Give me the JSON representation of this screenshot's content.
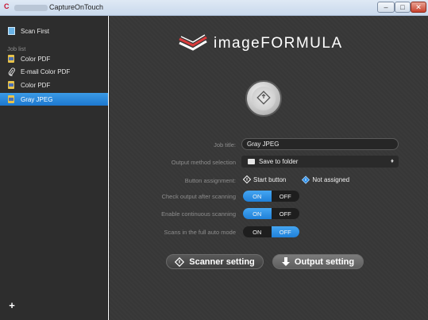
{
  "window": {
    "app_title": "CaptureOnTouch",
    "logo_text": "C",
    "controls": {
      "minimize": "–",
      "maximize": "□",
      "close": "✕"
    }
  },
  "sidebar": {
    "scan_first_label": "Scan First",
    "job_list_label": "Job list",
    "jobs": [
      {
        "label": "Color PDF",
        "icon": "pdf-icon"
      },
      {
        "label": "E-mail Color PDF",
        "icon": "paperclip-icon"
      },
      {
        "label": "Color PDF",
        "icon": "pdf-icon"
      },
      {
        "label": "Gray JPEG",
        "icon": "jpeg-icon",
        "selected": true
      }
    ],
    "add_label": "+"
  },
  "main": {
    "brand": "imageFORMULA",
    "job_title_label": "Job title:",
    "job_title_value": "Gray JPEG",
    "output_method_label": "Output method selection",
    "output_method_value": "Save to folder",
    "output_method_arrow": "♦",
    "button_assignment_label": "Button assignment:",
    "start_button_label": "Start button",
    "not_assigned_label": "Not assigned",
    "check_output_label": "Check output after scanning",
    "continuous_label": "Enable continuous scanning",
    "full_auto_label": "Scans in the full auto mode",
    "toggle_on": "ON",
    "toggle_off": "OFF",
    "check_output_state": "ON",
    "continuous_state": "ON",
    "full_auto_state": "OFF",
    "scanner_setting_label": "Scanner setting",
    "output_setting_label": "Output setting"
  },
  "colors": {
    "accent_blue": "#2a8ce6",
    "main_bg": "#3a3a3a",
    "sidebar_bg": "#2d2d2d"
  }
}
